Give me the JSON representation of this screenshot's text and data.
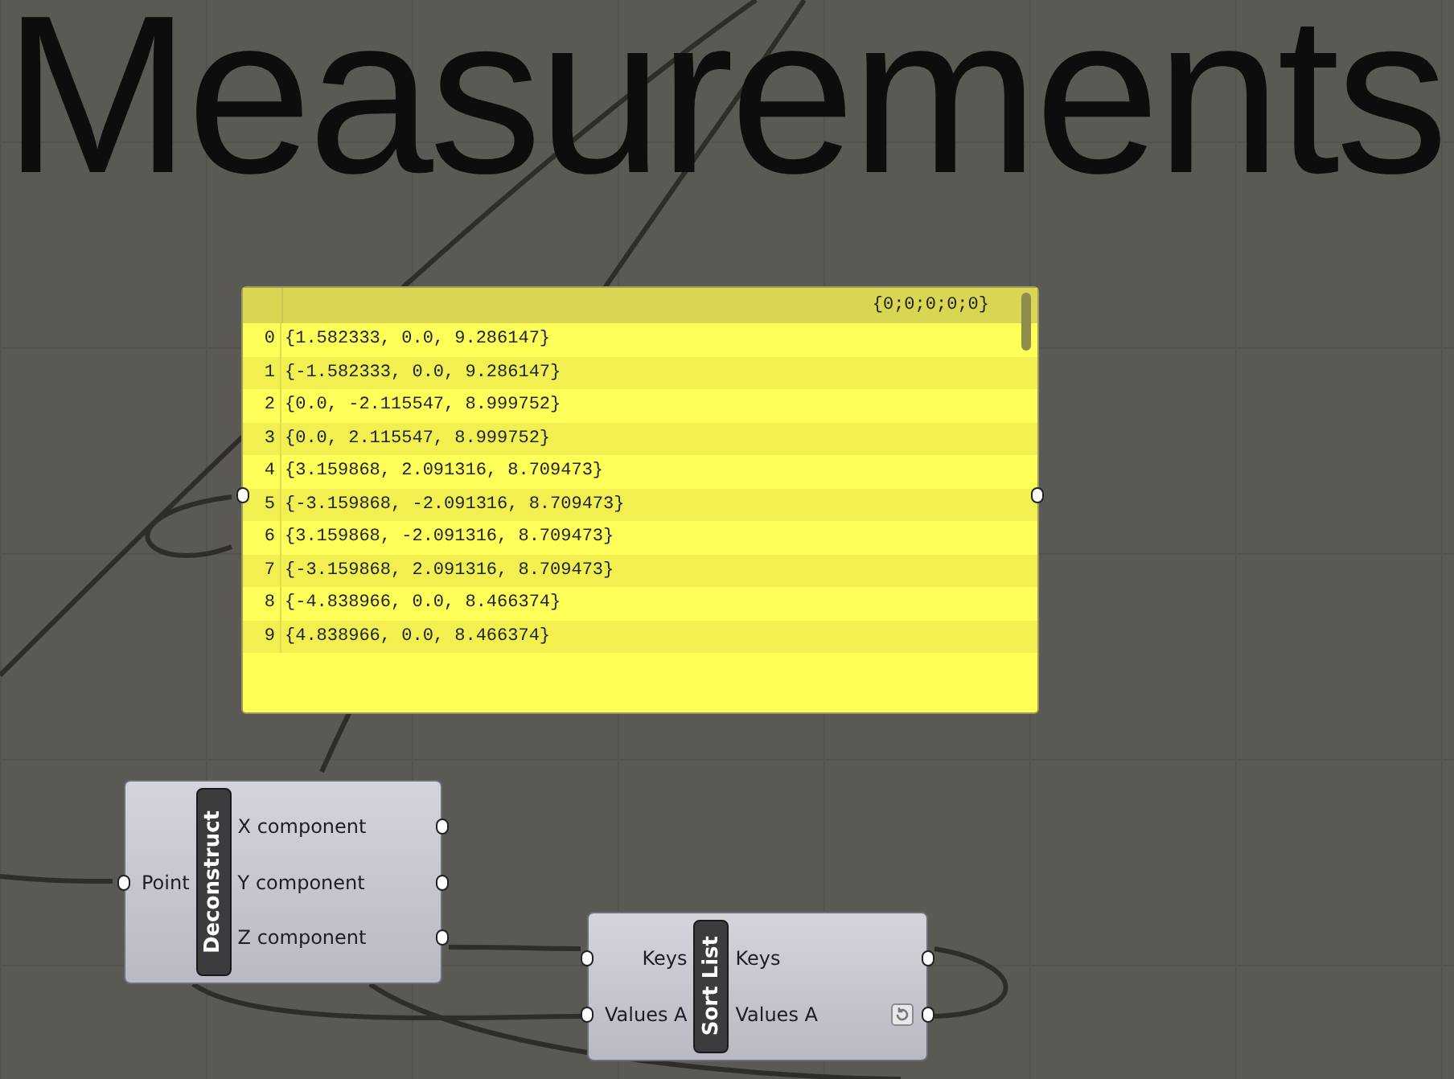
{
  "title": "Measurements",
  "panel": {
    "header": "{0;0;0;0;0}",
    "rows": [
      {
        "index": "0",
        "value": "{1.582333, 0.0, 9.286147}"
      },
      {
        "index": "1",
        "value": "{-1.582333, 0.0, 9.286147}"
      },
      {
        "index": "2",
        "value": "{0.0, -2.115547, 8.999752}"
      },
      {
        "index": "3",
        "value": "{0.0, 2.115547, 8.999752}"
      },
      {
        "index": "4",
        "value": "{3.159868, 2.091316, 8.709473}"
      },
      {
        "index": "5",
        "value": "{-3.159868, -2.091316, 8.709473}"
      },
      {
        "index": "6",
        "value": "{3.159868, -2.091316, 8.709473}"
      },
      {
        "index": "7",
        "value": "{-3.159868, 2.091316, 8.709473}"
      },
      {
        "index": "8",
        "value": "{-4.838966, 0.0, 8.466374}"
      },
      {
        "index": "9",
        "value": "{4.838966, 0.0, 8.466374}"
      }
    ]
  },
  "components": [
    {
      "name": "Deconstruct",
      "inputs": [
        "Point"
      ],
      "outputs": [
        "X component",
        "Y component",
        "Z component"
      ],
      "reset": false
    },
    {
      "name": "Sort List",
      "inputs": [
        "Keys",
        "Values A"
      ],
      "outputs": [
        "Keys",
        "Values A"
      ],
      "reset": true
    }
  ]
}
